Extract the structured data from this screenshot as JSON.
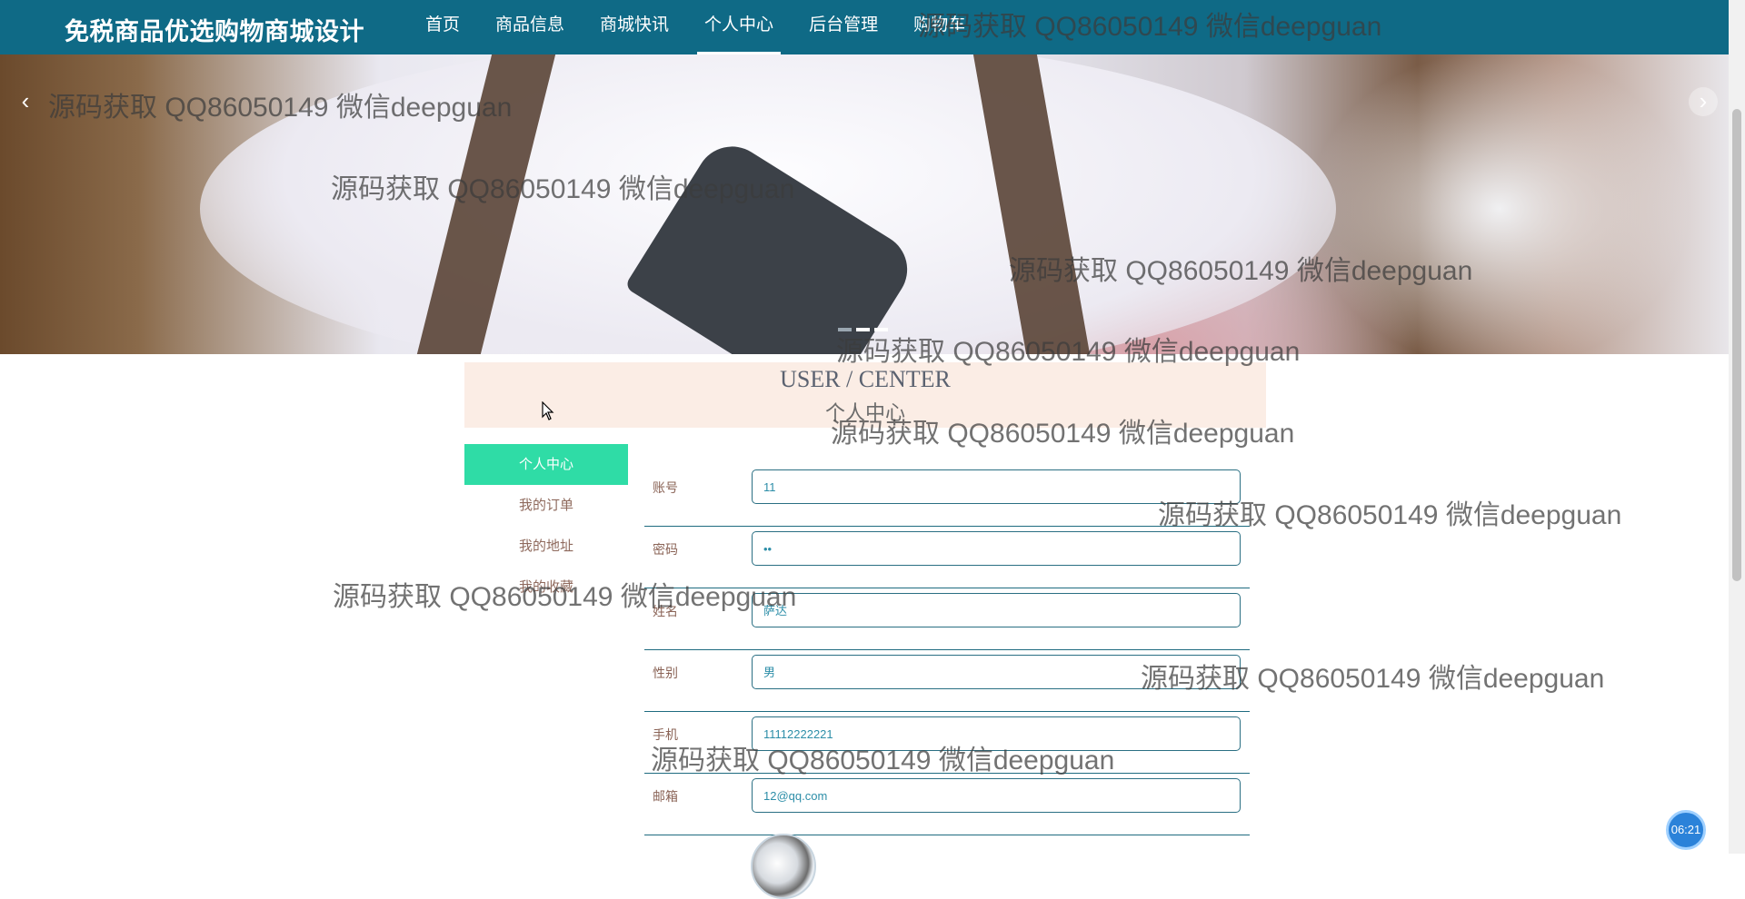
{
  "header": {
    "brand": "免税商品优选购物商城设计",
    "nav": [
      {
        "label": "首页"
      },
      {
        "label": "商品信息"
      },
      {
        "label": "商城快讯"
      },
      {
        "label": "个人中心"
      },
      {
        "label": "后台管理"
      },
      {
        "label": "购物车"
      }
    ],
    "active_nav": "个人中心"
  },
  "banner": {
    "prev_icon": "chevron-left-icon",
    "next_icon": "chevron-right-icon",
    "slide_count": 3,
    "active_slide": 1
  },
  "section": {
    "title_en": "USER / CENTER",
    "title_cn": "个人中心"
  },
  "sidebar": {
    "items": [
      {
        "label": "个人中心"
      },
      {
        "label": "我的订单"
      },
      {
        "label": "我的地址"
      },
      {
        "label": "我的收藏"
      }
    ],
    "active": "个人中心"
  },
  "form": {
    "fields": [
      {
        "label": "账号",
        "value": "11"
      },
      {
        "label": "密码",
        "value": "••"
      },
      {
        "label": "姓名",
        "value": "萨达"
      },
      {
        "label": "性别",
        "value": "男"
      },
      {
        "label": "手机",
        "value": "11112222221"
      },
      {
        "label": "邮箱",
        "value": "12@qq.com"
      }
    ]
  },
  "watermark": "源码获取 QQ86050149 微信deepguan",
  "clock": "06:21",
  "colors": {
    "nav_bg": "#0f6a86",
    "accent": "#2fdca6",
    "title_bg": "#fbede5",
    "input_border": "#2a6f83"
  }
}
